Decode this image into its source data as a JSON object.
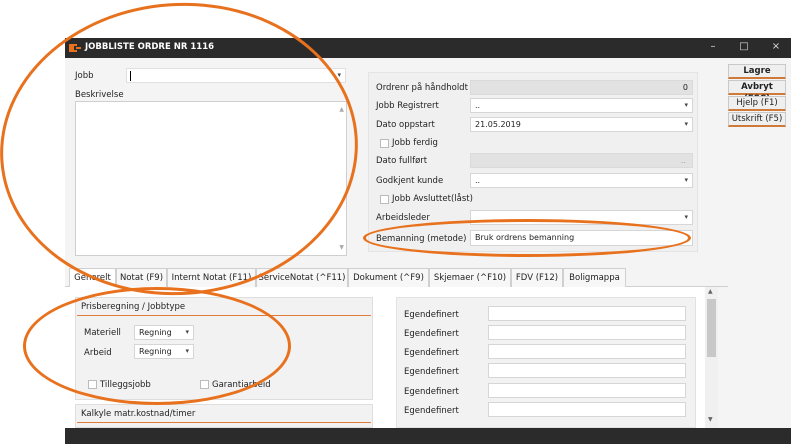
{
  "window": {
    "title": "JOBBLISTE ORDRE NR 1116",
    "minimize": "–",
    "maximize": "□",
    "close": "×"
  },
  "side_buttons": [
    "Lagre",
    "Avbryt (ESC)",
    "Hjelp (F1)",
    "Utskrift (F5)"
  ],
  "left": {
    "jobb_label": "Jobb",
    "jobb_value": "",
    "beskrivelse_label": "Beskrivelse",
    "beskrivelse_value": ""
  },
  "right_form": {
    "ordrenr_label": "Ordrenr på håndholdt",
    "ordrenr_value": "0",
    "jobb_reg_label": "Jobb Registrert",
    "jobb_reg_value": "..",
    "dato_oppstart_label": "Dato oppstart",
    "dato_oppstart_value": "21.05.2019",
    "jobb_ferdig_label": "Jobb ferdig",
    "dato_fullfort_label": "Dato fullført",
    "dato_fullfort_value": "..",
    "godkjent_label": "Godkjent kunde",
    "godkjent_value": "..",
    "avsluttet_label": "Jobb Avsluttet(låst)",
    "arbeidsleder_label": "Arbeidsleder",
    "arbeidsleder_value": "",
    "bemanning_label": "Bemanning (metode)",
    "bemanning_value": "Bruk ordrens bemanning"
  },
  "tabs": [
    "Generelt",
    "Notat (F9)",
    "Internt Notat (F11)",
    "ServiceNotat (^F11)",
    "Dokument (^F9)",
    "Skjemaer (^F10)",
    "FDV (F12)",
    "Boligmappa"
  ],
  "pris": {
    "header": "Prisberegning / Jobbtype",
    "materiell_label": "Materiell",
    "materiell_value": "Regning",
    "arbeid_label": "Arbeid",
    "arbeid_value": "Regning",
    "tilleggsjobb": "Tilleggsjobb",
    "garanti": "Garantiarbeid"
  },
  "kalkyle": {
    "header": "Kalkyle matr.kostnad/timer"
  },
  "egendefinert": [
    "Egendefinert",
    "Egendefinert",
    "Egendefinert",
    "Egendefinert",
    "Egendefinert",
    "Egendefinert"
  ],
  "icons": {
    "logo": "app-logo-icon",
    "dropdown": "chevron-down-icon",
    "scroll_up": "scroll-up-icon",
    "scroll_down": "scroll-down-icon"
  },
  "colors": {
    "titlebar": "#2b2b2b",
    "accent": "#e07b3c",
    "annotation": "#e8711e"
  }
}
